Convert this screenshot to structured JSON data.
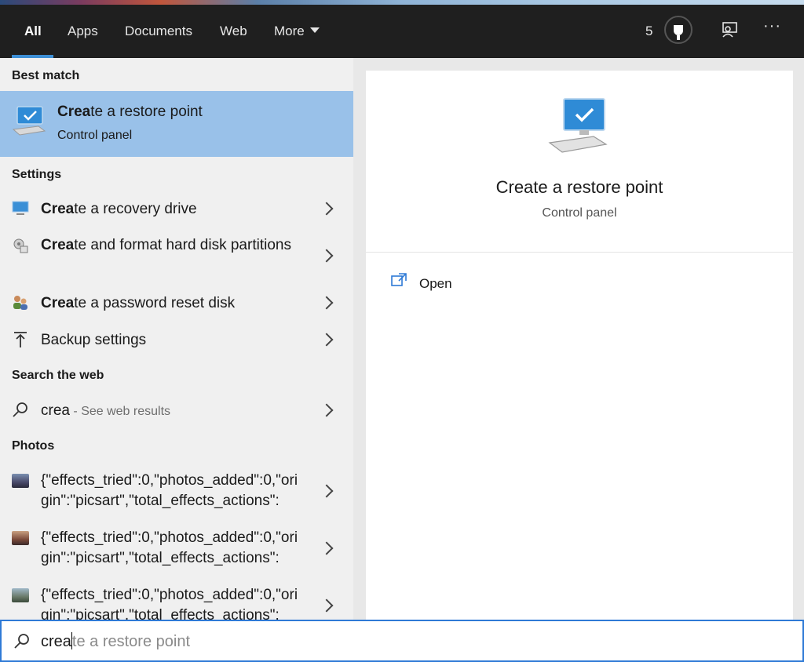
{
  "tabs": [
    "All",
    "Apps",
    "Documents",
    "Web",
    "More"
  ],
  "header": {
    "count": "5",
    "more_label": "···"
  },
  "sections": {
    "best_match": "Best match",
    "settings": "Settings",
    "search_web": "Search the web",
    "photos": "Photos"
  },
  "best_match": {
    "title_bold": "Crea",
    "title_rest": "te a restore point",
    "subtitle": "Control panel"
  },
  "settings_items": [
    {
      "bold": "Crea",
      "rest": "te a recovery drive",
      "icon": "monitor-icon"
    },
    {
      "bold": "Crea",
      "rest": "te and format hard disk partitions",
      "icon": "disk-management-icon"
    },
    {
      "bold": "Crea",
      "rest": "te a password reset disk",
      "icon": "users-icon"
    },
    {
      "bold": "",
      "rest": "Backup settings",
      "icon": "backup-arrow-icon"
    }
  ],
  "web_result": {
    "query": "crea",
    "suffix": " - See web results"
  },
  "photo_items": [
    "{\"effects_tried\":0,\"photos_added\":0,\"origin\":\"picsart\",\"total_effects_actions\":",
    "{\"effects_tried\":0,\"photos_added\":0,\"origin\":\"picsart\",\"total_effects_actions\":",
    "{\"effects_tried\":0,\"photos_added\":0,\"origin\":\"picsart\",\"total_effects_actions\":"
  ],
  "preview": {
    "title": "Create a restore point",
    "subtitle": "Control panel",
    "action_open": "Open"
  },
  "search": {
    "typed": "crea",
    "completion": "te a restore point"
  },
  "colors": {
    "accent": "#3d8fd6",
    "selected_bg": "#99c1e9",
    "topbar_bg": "#1f1f1f"
  }
}
